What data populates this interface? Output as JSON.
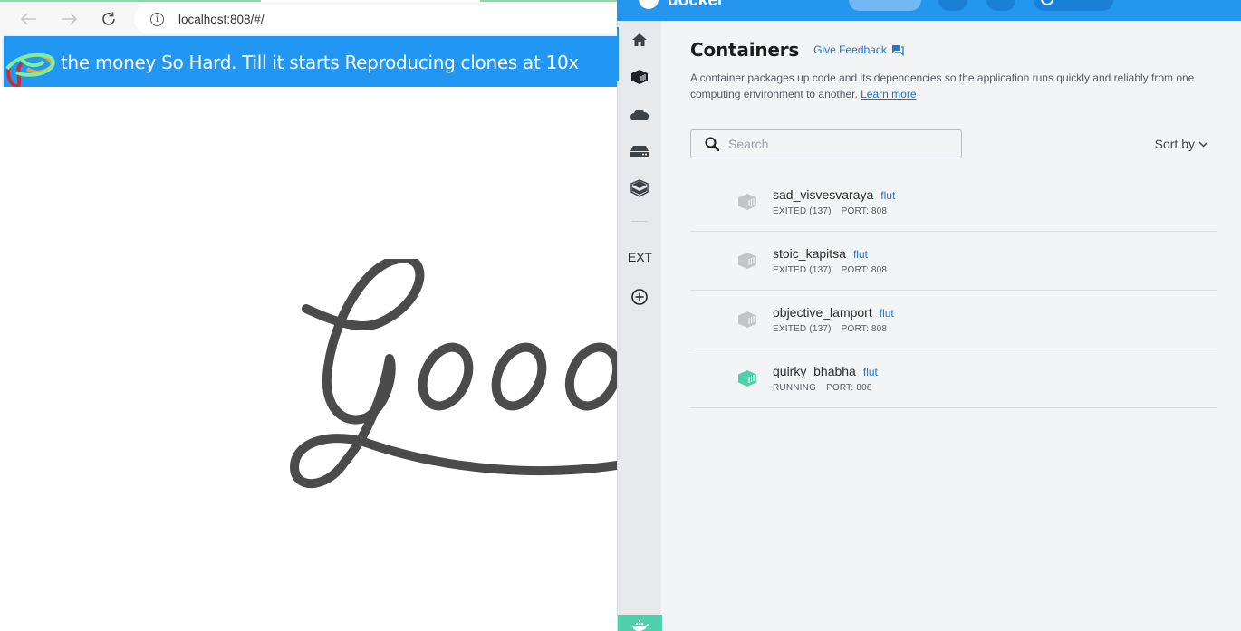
{
  "browser": {
    "url": "localhost:808/#/",
    "app_bar_title": "the money So Hard. Till it starts Reproducing clones at 10x",
    "page_art_text": "Good"
  },
  "docker": {
    "header": {
      "brand": "docker"
    },
    "sidebar": {
      "items": [
        {
          "name": "home",
          "icon": "home-icon"
        },
        {
          "name": "containers",
          "icon": "container-icon",
          "active": true
        },
        {
          "name": "cloud",
          "icon": "cloud-icon"
        },
        {
          "name": "volumes",
          "icon": "drive-icon"
        },
        {
          "name": "dev-environments",
          "icon": "box-icon"
        }
      ],
      "ext_label": "EXT",
      "add_extension": "plus-circle-icon"
    },
    "main": {
      "title": "Containers",
      "feedback_label": "Give Feedback",
      "description": "A container packages up code and its dependencies so the application runs quickly and reliably from one computing environment to another.",
      "learn_more": "Learn more",
      "search_placeholder": "Search",
      "sort_label": "Sort by",
      "containers": [
        {
          "name": "sad_visvesvaraya",
          "image": "flut",
          "status": "EXITED (137)",
          "port": "PORT: 808",
          "running": false
        },
        {
          "name": "stoic_kapitsa",
          "image": "flut",
          "status": "EXITED (137)",
          "port": "PORT: 808",
          "running": false
        },
        {
          "name": "objective_lamport",
          "image": "flut",
          "status": "EXITED (137)",
          "port": "PORT: 808",
          "running": false
        },
        {
          "name": "quirky_bhabha",
          "image": "flut",
          "status": "RUNNING",
          "port": "PORT: 808",
          "running": true
        }
      ]
    },
    "colors": {
      "accent": "#2496ed",
      "running": "#4fd1ae",
      "stopped": "#c4c4c4",
      "link": "#2178c9"
    }
  }
}
